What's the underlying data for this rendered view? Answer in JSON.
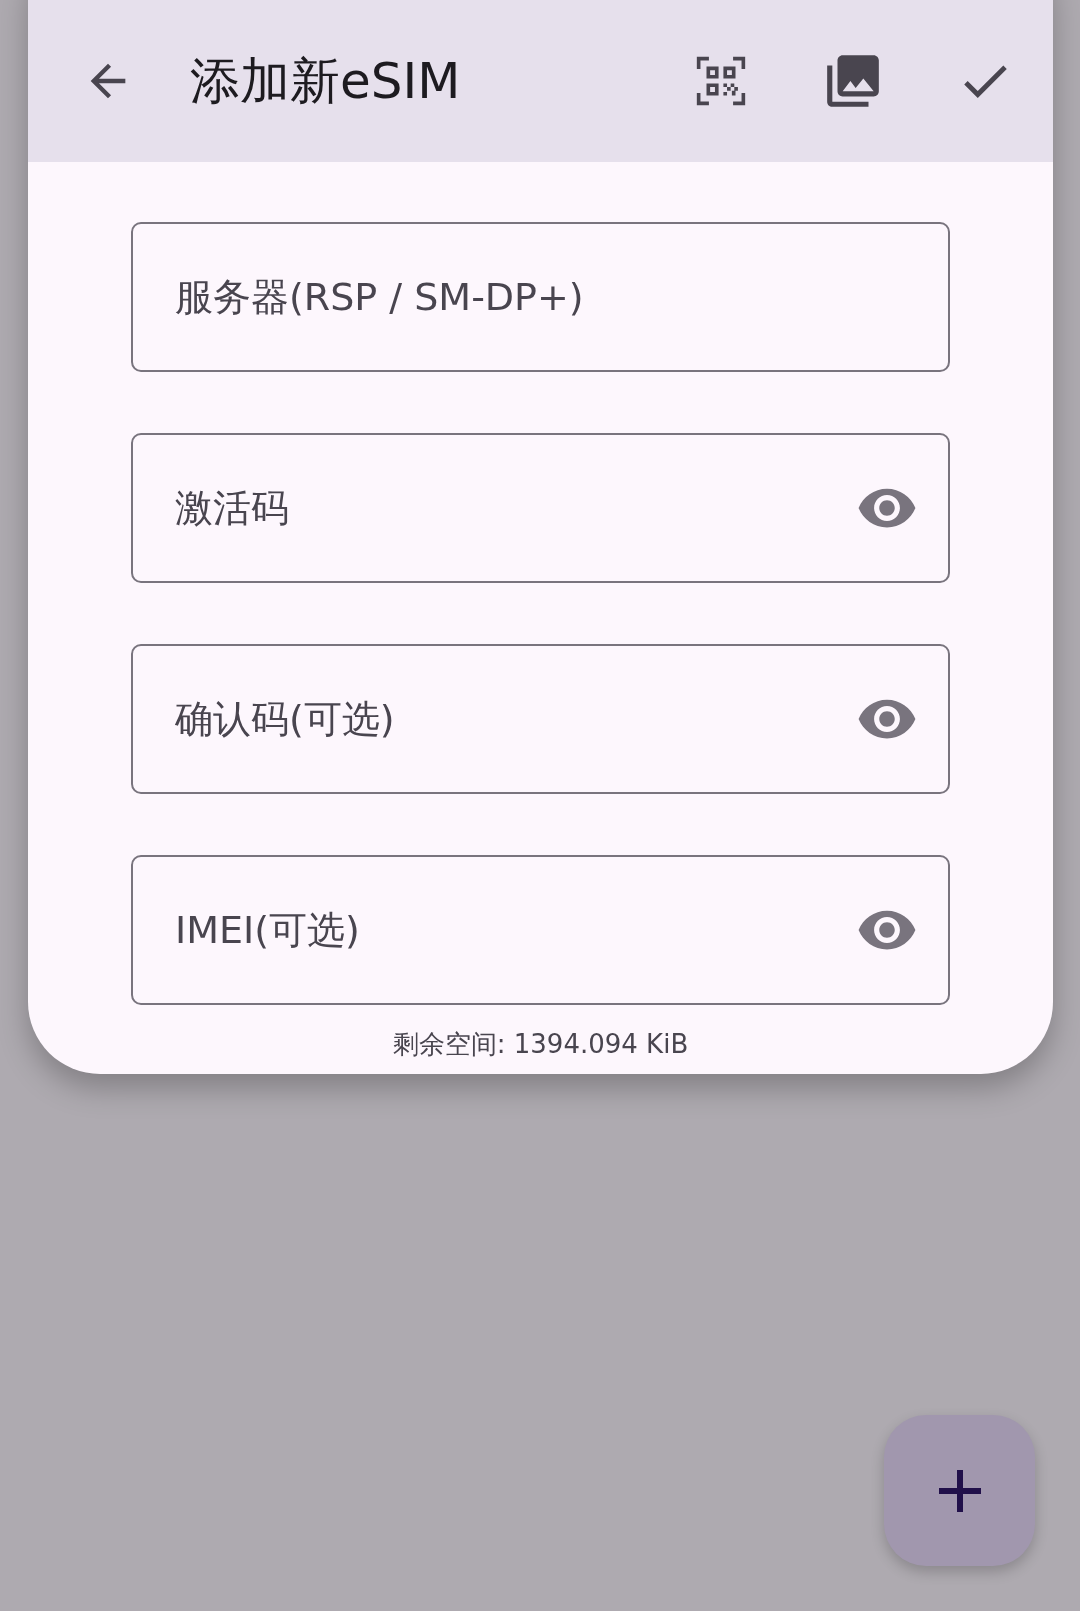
{
  "toolbar": {
    "title": "添加新eSIM"
  },
  "fields": [
    {
      "placeholder": "服务器(RSP / SM-DP+)",
      "kind": "plain"
    },
    {
      "placeholder": "激活码",
      "kind": "secret"
    },
    {
      "placeholder": "确认码(可选)",
      "kind": "secret"
    },
    {
      "placeholder": "IMEI(可选)",
      "kind": "secret"
    }
  ],
  "footer": "剩余空间: 1394.094 KiB"
}
